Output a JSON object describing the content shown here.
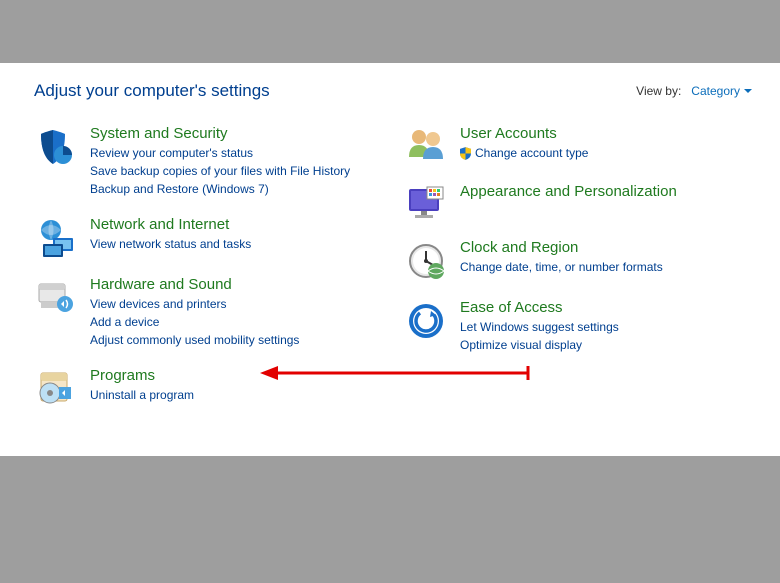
{
  "header": {
    "title": "Adjust your computer's settings",
    "viewby_label": "View by:",
    "viewby_value": "Category"
  },
  "left": [
    {
      "title": "System and Security",
      "links": [
        "Review your computer's status",
        "Save backup copies of your files with File History",
        "Backup and Restore (Windows 7)"
      ]
    },
    {
      "title": "Network and Internet",
      "links": [
        "View network status and tasks"
      ]
    },
    {
      "title": "Hardware and Sound",
      "links": [
        "View devices and printers",
        "Add a device",
        "Adjust commonly used mobility settings"
      ]
    },
    {
      "title": "Programs",
      "links": [
        "Uninstall a program"
      ]
    }
  ],
  "right": [
    {
      "title": "User Accounts",
      "links": [
        "Change account type"
      ],
      "shield": true
    },
    {
      "title": "Appearance and Personalization",
      "links": []
    },
    {
      "title": "Clock and Region",
      "links": [
        "Change date, time, or number formats"
      ]
    },
    {
      "title": "Ease of Access",
      "links": [
        "Let Windows suggest settings",
        "Optimize visual display"
      ]
    }
  ]
}
